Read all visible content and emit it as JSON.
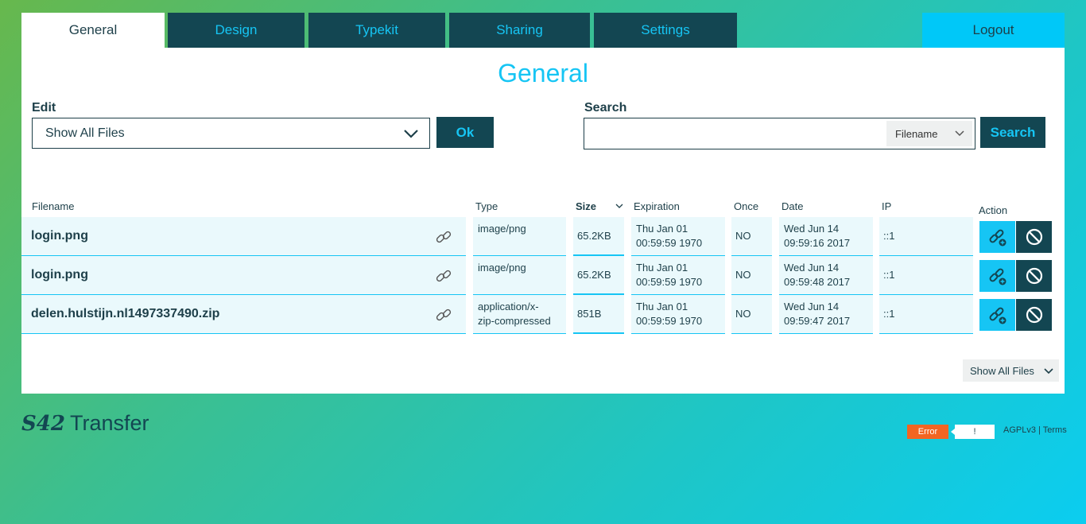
{
  "tabs": [
    {
      "label": "General"
    },
    {
      "label": "Design"
    },
    {
      "label": "Typekit"
    },
    {
      "label": "Sharing"
    },
    {
      "label": "Settings"
    }
  ],
  "logout_label": "Logout",
  "page_title": "General",
  "edit": {
    "label": "Edit",
    "selected": "Show All Files",
    "ok_label": "Ok"
  },
  "search": {
    "label": "Search",
    "value": "",
    "filter": "Filename",
    "button_label": "Search"
  },
  "table": {
    "headers": {
      "filename": "Filename",
      "type": "Type",
      "size": "Size",
      "expiration": "Expiration",
      "once": "Once",
      "date": "Date",
      "ip": "IP",
      "action": "Action"
    },
    "rows": [
      {
        "filename": "login.png",
        "type": "image/png",
        "size": "65.2KB",
        "expiration": "Thu Jan 01\n00:59:59 1970",
        "once": "NO",
        "date": "Wed Jun 14\n09:59:16 2017",
        "ip": "::1"
      },
      {
        "filename": "login.png",
        "type": "image/png",
        "size": "65.2KB",
        "expiration": "Thu Jan 01\n00:59:59 1970",
        "once": "NO",
        "date": "Wed Jun 14\n09:59:48 2017",
        "ip": "::1"
      },
      {
        "filename": "delen.hulstijn.nl1497337490.zip",
        "type": "application/x-\nzip-compressed",
        "size": "851B",
        "expiration": "Thu Jan 01\n00:59:59 1970",
        "once": "NO",
        "date": "Wed Jun 14\n09:59:47 2017",
        "ip": "::1"
      }
    ]
  },
  "bottom_filter": "Show All Files",
  "brand": {
    "logo": "S42",
    "name": "Transfer"
  },
  "status": {
    "error_label": "Error",
    "message": "!"
  },
  "footer": {
    "license": "AGPLv3",
    "separator": " | ",
    "terms": "Terms"
  },
  "colors": {
    "accent": "#16c5f4",
    "dark": "#134652",
    "error": "#f26522"
  }
}
